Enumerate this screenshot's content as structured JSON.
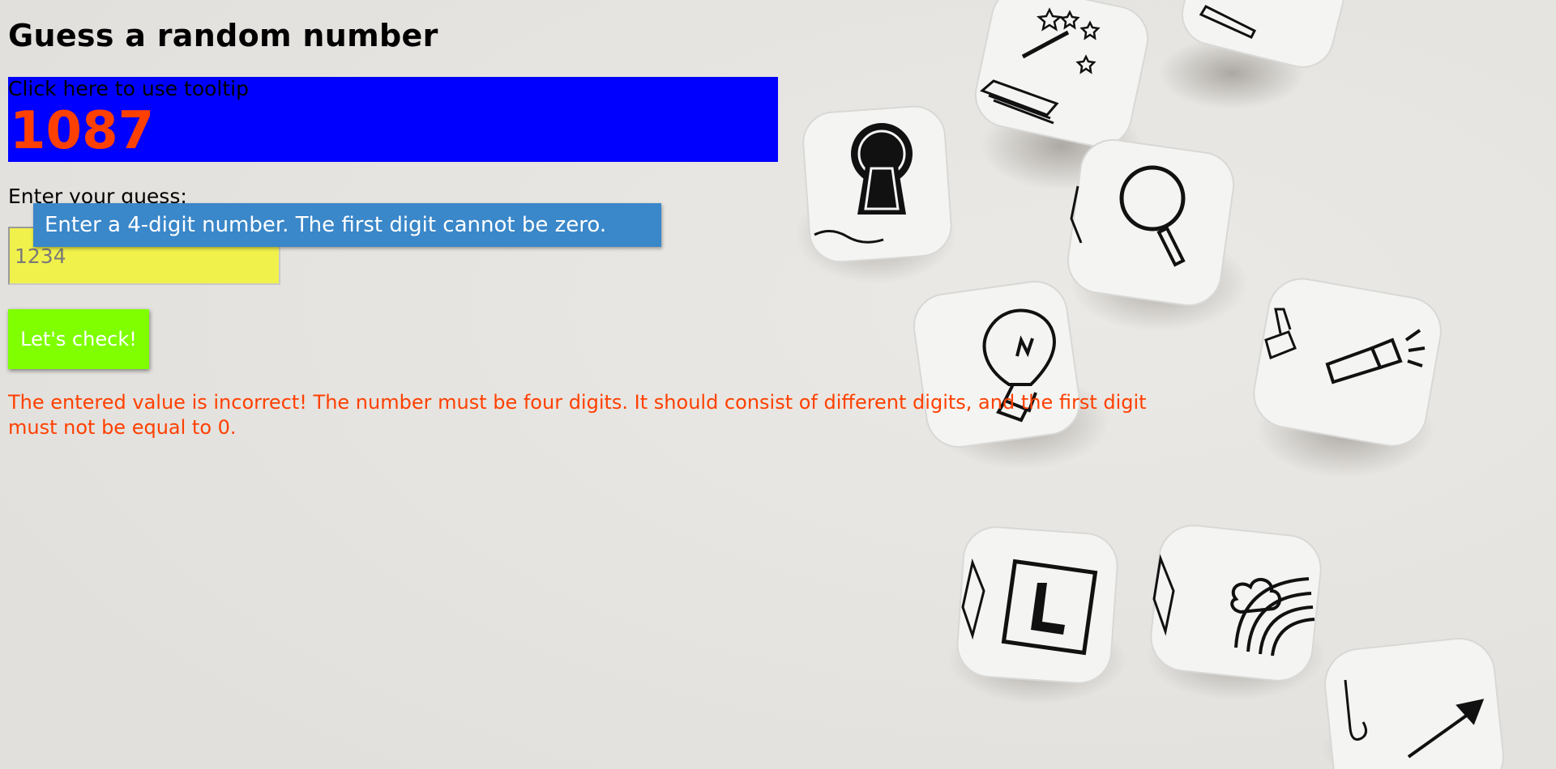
{
  "page": {
    "title": "Guess a random number"
  },
  "number_box": {
    "tooltip_trigger": "Click here to use tooltip",
    "secret_number": "1087",
    "background_color": "#0000ff",
    "number_color": "#ff4000"
  },
  "guess": {
    "label": "Enter your guess:",
    "placeholder": "1234",
    "value": "",
    "tooltip": "Enter a 4-digit number. The first digit cannot be zero."
  },
  "check_button": {
    "label": "Let's check!",
    "color": "#7fff00"
  },
  "error_message": "The entered value is incorrect! The number must be four digits. It should consist of different digits, and the first digit must not be equal to 0.",
  "background": {
    "image": "dice-background",
    "dice_icons": [
      "magic-wand-icon",
      "book-icon",
      "keyhole-icon",
      "magnifier-icon",
      "lightbulb-icon",
      "flashlight-icon",
      "airplane-icon",
      "l-sign-icon",
      "rainbow-icon",
      "arrow-icon",
      "cane-icon",
      "cellphone-icon"
    ]
  }
}
